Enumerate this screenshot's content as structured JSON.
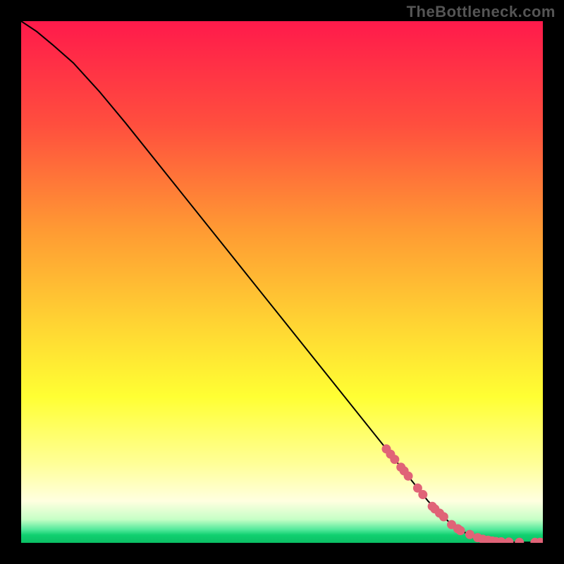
{
  "watermark": "TheBottleneck.com",
  "colors": {
    "gradient_top": "#ff1a4b",
    "gradient_mid_upper": "#ff7a33",
    "gradient_mid": "#ffd433",
    "gradient_lower": "#ffff66",
    "gradient_pale": "#ffffcc",
    "gradient_green": "#10e070",
    "dot": "#e06377",
    "curve": "#000000",
    "frame": "#000000"
  },
  "chart_data": {
    "type": "line",
    "title": "",
    "xlabel": "",
    "ylabel": "",
    "xlim": [
      0,
      100
    ],
    "ylim": [
      0,
      100
    ],
    "series": [
      {
        "name": "curve",
        "x": [
          0,
          3,
          6,
          10,
          15,
          20,
          30,
          40,
          50,
          60,
          70,
          78,
          82,
          85,
          88,
          90,
          92,
          95,
          98,
          100
        ],
        "y": [
          100,
          98,
          95.5,
          92,
          86.5,
          80.5,
          68,
          55.5,
          43,
          30.5,
          18,
          8,
          4,
          2,
          0.8,
          0.4,
          0.2,
          0.1,
          0.1,
          0.1
        ]
      }
    ],
    "scatter_points": {
      "name": "dots-on-curve",
      "points": [
        {
          "x": 70.0,
          "y": 18.0
        },
        {
          "x": 70.8,
          "y": 17.0
        },
        {
          "x": 71.6,
          "y": 16.0
        },
        {
          "x": 72.8,
          "y": 14.5
        },
        {
          "x": 73.4,
          "y": 13.8
        },
        {
          "x": 74.2,
          "y": 12.8
        },
        {
          "x": 76.0,
          "y": 10.5
        },
        {
          "x": 77.0,
          "y": 9.25
        },
        {
          "x": 78.8,
          "y": 7.0
        },
        {
          "x": 79.3,
          "y": 6.5
        },
        {
          "x": 80.2,
          "y": 5.7
        },
        {
          "x": 81.0,
          "y": 5.0
        },
        {
          "x": 82.5,
          "y": 3.5
        },
        {
          "x": 83.7,
          "y": 2.7
        },
        {
          "x": 84.2,
          "y": 2.35
        },
        {
          "x": 86.0,
          "y": 1.6
        },
        {
          "x": 87.5,
          "y": 1.0
        },
        {
          "x": 88.5,
          "y": 0.7
        },
        {
          "x": 89.5,
          "y": 0.5
        },
        {
          "x": 90.3,
          "y": 0.35
        },
        {
          "x": 91.0,
          "y": 0.25
        },
        {
          "x": 92.0,
          "y": 0.2
        },
        {
          "x": 93.5,
          "y": 0.15
        },
        {
          "x": 95.5,
          "y": 0.1
        },
        {
          "x": 98.5,
          "y": 0.1
        },
        {
          "x": 99.5,
          "y": 0.1
        }
      ]
    },
    "background_gradient_stops": [
      {
        "offset": 0.0,
        "color": "#ff1a4b"
      },
      {
        "offset": 0.2,
        "color": "#ff4f3e"
      },
      {
        "offset": 0.4,
        "color": "#ff9a33"
      },
      {
        "offset": 0.58,
        "color": "#ffd433"
      },
      {
        "offset": 0.72,
        "color": "#ffff33"
      },
      {
        "offset": 0.85,
        "color": "#ffff99"
      },
      {
        "offset": 0.92,
        "color": "#ffffe0"
      },
      {
        "offset": 0.955,
        "color": "#c6ffc6"
      },
      {
        "offset": 0.975,
        "color": "#50e89a"
      },
      {
        "offset": 0.985,
        "color": "#10d070"
      },
      {
        "offset": 1.0,
        "color": "#0bbf64"
      }
    ]
  }
}
